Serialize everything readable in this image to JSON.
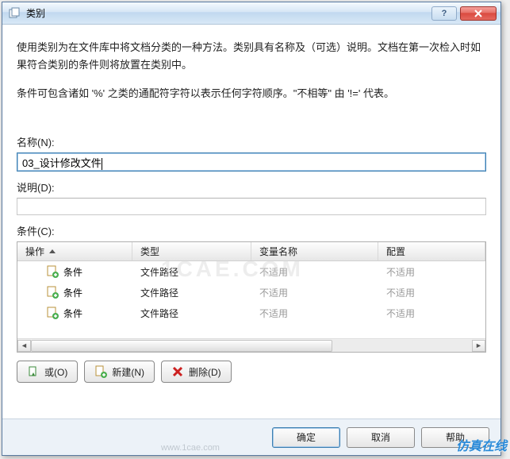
{
  "window": {
    "title": "类别"
  },
  "intro": {
    "line1": "使用类别为在文件库中将文档分类的一种方法。类别具有名称及（可选）说明。文档在第一次检入时如果符合类别的条件则将放置在类别中。",
    "line2": "条件可包含诸如 '%' 之类的通配符字符以表示任何字符顺序。\"不相等\" 由 '!=' 代表。"
  },
  "labels": {
    "name": "名称(N):",
    "desc": "说明(D):",
    "cond": "条件(C):"
  },
  "fields": {
    "name_value": "03_设计修改文件"
  },
  "table": {
    "headers": {
      "op": "操作",
      "type": "类型",
      "var": "变量名称",
      "cfg": "配置"
    },
    "rows": [
      {
        "op": "条件",
        "type": "文件路径",
        "var": "不适用",
        "cfg": "不适用"
      },
      {
        "op": "条件",
        "type": "文件路径",
        "var": "不适用",
        "cfg": "不适用"
      },
      {
        "op": "条件",
        "type": "文件路径",
        "var": "不适用",
        "cfg": "不适用"
      }
    ]
  },
  "toolbar": {
    "or": "或(O)",
    "new": "新建(N)",
    "delete": "删除(D)"
  },
  "footer": {
    "ok": "确定",
    "cancel": "取消",
    "help": "帮助"
  },
  "watermark": "1CAE.COM",
  "wm2": "www.1cae.com",
  "corner": "仿真在线"
}
